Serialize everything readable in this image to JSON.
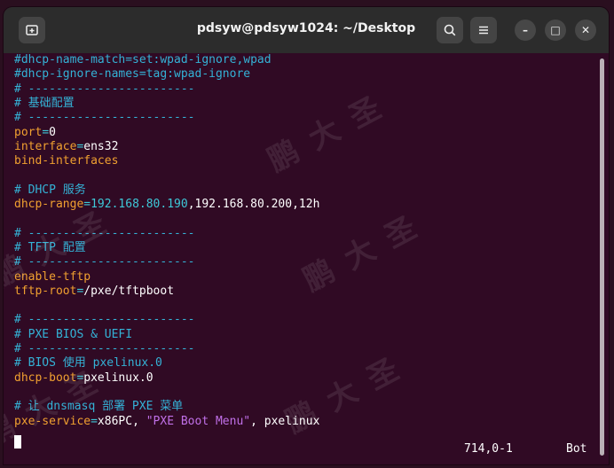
{
  "window": {
    "title": "pdsyw@pdsyw1024: ~/Desktop",
    "new_tab_icon": "new-tab-icon",
    "search_icon": "search-icon",
    "menu_icon": "hamburger-menu-icon",
    "minimize_glyph": "–",
    "maximize_glyph": "□",
    "close_glyph": "✕"
  },
  "lines": [
    {
      "segments": [
        {
          "t": "#dhcp-name-match=set:wpad-ignore,wpad",
          "c": "comment"
        }
      ]
    },
    {
      "segments": [
        {
          "t": "#dhcp-ignore-names=tag:wpad-ignore",
          "c": "comment"
        }
      ]
    },
    {
      "segments": [
        {
          "t": "# ------------------------",
          "c": "comment"
        }
      ]
    },
    {
      "segments": [
        {
          "t": "# 基础配置",
          "c": "comment"
        }
      ]
    },
    {
      "segments": [
        {
          "t": "# ------------------------",
          "c": "comment"
        }
      ]
    },
    {
      "segments": [
        {
          "t": "port",
          "c": "key"
        },
        {
          "t": "=",
          "c": "eq"
        },
        {
          "t": "0",
          "c": "val"
        }
      ]
    },
    {
      "segments": [
        {
          "t": "interface",
          "c": "key"
        },
        {
          "t": "=",
          "c": "eq"
        },
        {
          "t": "ens32",
          "c": "val"
        }
      ]
    },
    {
      "segments": [
        {
          "t": "bind-interfaces",
          "c": "key"
        }
      ]
    },
    {
      "segments": []
    },
    {
      "segments": [
        {
          "t": "# DHCP 服务",
          "c": "comment"
        }
      ]
    },
    {
      "segments": [
        {
          "t": "dhcp-range",
          "c": "key"
        },
        {
          "t": "=",
          "c": "eq"
        },
        {
          "t": "192.168.80.190",
          "c": "eq"
        },
        {
          "t": ",192.168.80.200,12h",
          "c": "val"
        }
      ]
    },
    {
      "segments": []
    },
    {
      "segments": [
        {
          "t": "# ------------------------",
          "c": "comment"
        }
      ]
    },
    {
      "segments": [
        {
          "t": "# TFTP 配置",
          "c": "comment"
        }
      ]
    },
    {
      "segments": [
        {
          "t": "# ------------------------",
          "c": "comment"
        }
      ]
    },
    {
      "segments": [
        {
          "t": "enable-tftp",
          "c": "key"
        }
      ]
    },
    {
      "segments": [
        {
          "t": "tftp-root",
          "c": "key"
        },
        {
          "t": "=",
          "c": "eq"
        },
        {
          "t": "/pxe/tftpboot",
          "c": "val"
        }
      ]
    },
    {
      "segments": []
    },
    {
      "segments": [
        {
          "t": "# ------------------------",
          "c": "comment"
        }
      ]
    },
    {
      "segments": [
        {
          "t": "# PXE BIOS & UEFI",
          "c": "comment"
        }
      ]
    },
    {
      "segments": [
        {
          "t": "# ------------------------",
          "c": "comment"
        }
      ]
    },
    {
      "segments": [
        {
          "t": "# BIOS 使用 pxelinux.0",
          "c": "comment"
        }
      ]
    },
    {
      "segments": [
        {
          "t": "dhcp-boot",
          "c": "key"
        },
        {
          "t": "=",
          "c": "eq"
        },
        {
          "t": "pxelinux.0",
          "c": "val"
        }
      ]
    },
    {
      "segments": []
    },
    {
      "segments": [
        {
          "t": "# 让 dnsmasq 部署 PXE 菜单",
          "c": "comment"
        }
      ]
    },
    {
      "segments": [
        {
          "t": "pxe-service",
          "c": "key"
        },
        {
          "t": "=",
          "c": "eq"
        },
        {
          "t": "x86PC",
          "c": "val"
        },
        {
          "t": ", ",
          "c": "val"
        },
        {
          "t": "\"PXE Boot Menu\"",
          "c": "str"
        },
        {
          "t": ", pxelinux",
          "c": "val"
        }
      ]
    }
  ],
  "status": {
    "position": "714,0-1",
    "scroll": "Bot"
  },
  "watermark": "鹏大圣"
}
